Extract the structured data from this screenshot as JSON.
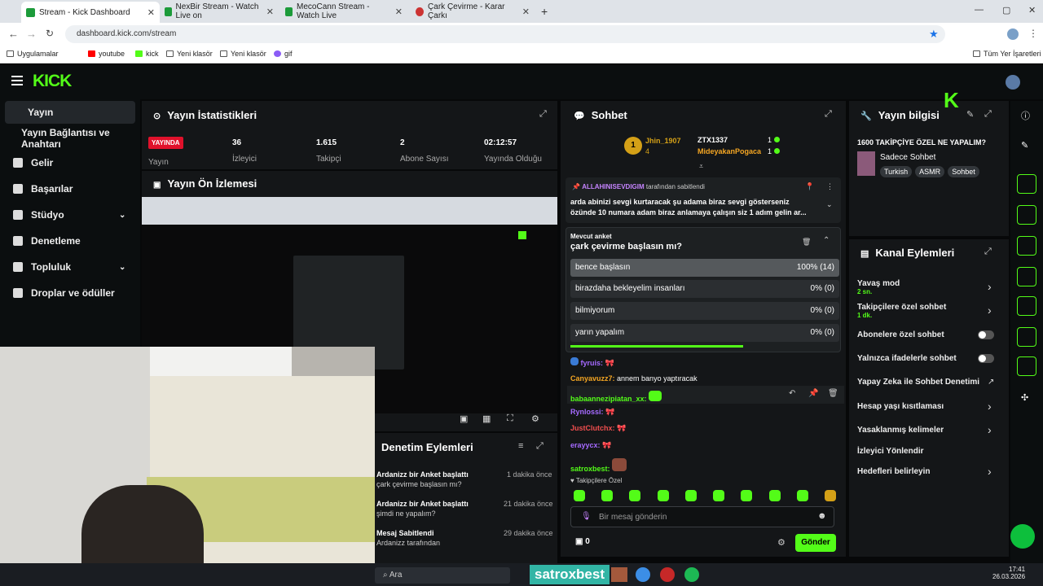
{
  "tabs": [
    {
      "label": "Stream - Kick Dashboard"
    },
    {
      "label": "NexBir Stream - Watch Live on"
    },
    {
      "label": "MecoCann Stream - Watch Live"
    },
    {
      "label": "Çark Çevirme - Karar Çarkı"
    }
  ],
  "url": "dashboard.kick.com/stream",
  "bookmarks": [
    "Uygulamalar",
    "youtube",
    "kick",
    "Yeni klasör",
    "Yeni klasör",
    "gif"
  ],
  "bookmarks_right": "Tüm Yer İşaretleri",
  "logo": "KICK",
  "sidebar": [
    {
      "label": "Yayın"
    },
    {
      "label": "Yayın Bağlantısı ve Anahtarı"
    },
    {
      "label": "Gelir"
    },
    {
      "label": "Başarılar"
    },
    {
      "label": "Stüdyo"
    },
    {
      "label": "Denetleme"
    },
    {
      "label": "Topluluk"
    },
    {
      "label": "Droplar ve ödüller"
    }
  ],
  "stats": {
    "title": "Yayın İstatistikleri",
    "live": "YAYINDA",
    "live_label": "Yayın",
    "viewers": "36",
    "viewers_label": "İzleyici",
    "followers": "1.615",
    "followers_label": "Takipçi",
    "subs": "2",
    "subs_label": "Abone Sayısı",
    "uptime": "02:12:57",
    "uptime_label": "Yayında Olduğu"
  },
  "preview": {
    "title": "Yayın Ön İzlemesi"
  },
  "moderation": {
    "title": "Denetim Eylemleri",
    "items": [
      {
        "user": "Ardanizz",
        "action": "bir Anket başlattı",
        "time": "1 dakika önce",
        "sub": "çark çevirme başlasın mı?"
      },
      {
        "user": "Ardanizz",
        "action": "bir Anket başlattı",
        "time": "21 dakika önce",
        "sub": "şimdi ne yapalım?"
      },
      {
        "user": "Mesaj Sabitlendi",
        "action": "",
        "time": "29 dakika önce",
        "sub": "Ardanizz tarafından"
      }
    ]
  },
  "chat": {
    "title": "Sohbet",
    "leader1": {
      "name": "Jhin_1907",
      "count": "4",
      "rank": "1"
    },
    "leader2": {
      "name": "ZTX1337",
      "count": "1"
    },
    "leader3": {
      "name": "MideyakanPogaca",
      "count": "1"
    },
    "pinned_user": "ALLAHINISEVDIGIM",
    "pinned_by": "tarafından sabitlendi",
    "pinned_text": "arda abinizi sevgi kurtaracak şu adama biraz sevgi gösterseniz özünde 10 numara adam biraz anlamaya çalışın siz 1 adım gelin ar...",
    "poll_label": "Mevcut anket",
    "poll_question": "çark çevirme başlasın mı?",
    "poll_options": [
      {
        "label": "bence başlasın",
        "result": "100% (14)"
      },
      {
        "label": "birazdaha bekleyelim insanları",
        "result": "0% (0)"
      },
      {
        "label": "bilmiyorum",
        "result": "0% (0)"
      },
      {
        "label": "yarın yapalım",
        "result": "0% (0)"
      }
    ],
    "messages": [
      {
        "user": "fyruis",
        "text": ""
      },
      {
        "user": "Canyavuzz7",
        "text": " annem banyo yaptıracak"
      },
      {
        "user": "babaannezipiatan_xx",
        "text": ""
      },
      {
        "user": "Rynlossi",
        "text": ""
      },
      {
        "user": "JustClutchx",
        "text": ""
      },
      {
        "user": "erayycx",
        "text": ""
      },
      {
        "user": "satroxbest",
        "text": ""
      }
    ],
    "followers_only": "Takipçilere Özel",
    "input_placeholder": "Bir mesaj gönderin",
    "points": "0",
    "send": "Gönder"
  },
  "info": {
    "title": "Yayın bilgisi",
    "stream_title": "1600 TAKİPÇİYE ÖZEL NE YAPALIM?",
    "category": "Sadece Sohbet",
    "tags": [
      "Turkish",
      "ASMR",
      "Sohbet"
    ]
  },
  "channel": {
    "title": "Kanal Eylemleri",
    "items": [
      {
        "label": "Yavaş mod",
        "sub": "2 sn.",
        "ctrl": "arrow"
      },
      {
        "label": "Takipçilere özel sohbet",
        "sub": "1 dk.",
        "ctrl": "arrow"
      },
      {
        "label": "Abonelere özel sohbet",
        "sub": "",
        "ctrl": "toggle"
      },
      {
        "label": "Yalnızca ifadelerle sohbet",
        "sub": "",
        "ctrl": "toggle"
      },
      {
        "label": "Yapay Zeka ile Sohbet Denetimi",
        "sub": "",
        "ctrl": "ext"
      },
      {
        "label": "Hesap yaşı kısıtlaması",
        "sub": "",
        "ctrl": "arrow"
      },
      {
        "label": "Yasaklanmış kelimeler",
        "sub": "",
        "ctrl": "arrow"
      },
      {
        "label": "İzleyici Yönlendir",
        "sub": "",
        "ctrl": ""
      },
      {
        "label": "Hedefleri belirleyin",
        "sub": "",
        "ctrl": "arrow"
      }
    ]
  },
  "taskbar": {
    "search": "Ara",
    "name": "satroxbest",
    "time": "17:41",
    "date": "26.03.2026"
  },
  "colors": {
    "kick_green": "#53fc18",
    "live_red": "#e0112b",
    "gold": "#d4a017"
  }
}
